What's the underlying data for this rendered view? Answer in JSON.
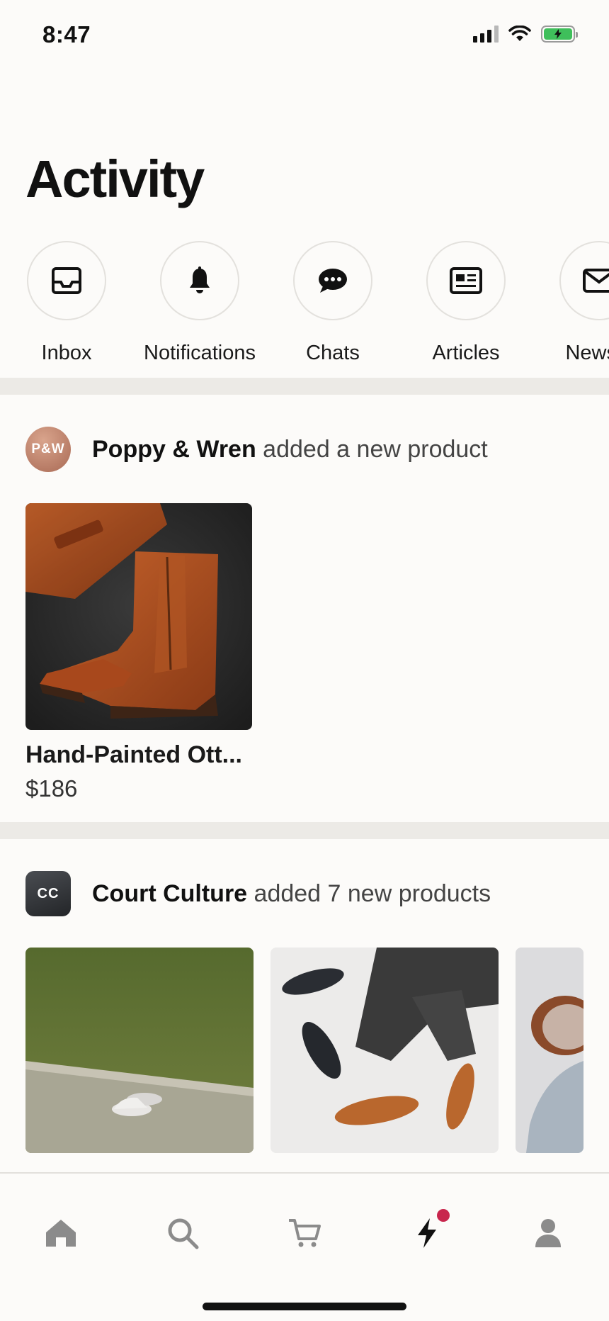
{
  "status_bar": {
    "time": "8:47"
  },
  "page_title": "Activity",
  "categories": [
    {
      "label": "Inbox",
      "icon": "inbox-icon"
    },
    {
      "label": "Notifications",
      "icon": "bell-icon"
    },
    {
      "label": "Chats",
      "icon": "chat-bubble-icon"
    },
    {
      "label": "Articles",
      "icon": "newspaper-icon"
    },
    {
      "label": "Newsle",
      "icon": "envelope-icon",
      "has_badge": true
    }
  ],
  "feed": [
    {
      "shop_initials": "P&W",
      "shop_name": "Poppy & Wren",
      "action": " added a new product",
      "products": [
        {
          "name": "Hand-Painted Ott...",
          "price": "$186"
        }
      ]
    },
    {
      "shop_initials": "CC",
      "shop_name": "Court Culture",
      "action": " added 7 new products"
    }
  ],
  "tab_bar": [
    {
      "icon": "home-icon"
    },
    {
      "icon": "search-icon"
    },
    {
      "icon": "cart-icon"
    },
    {
      "icon": "lightning-icon",
      "active": true,
      "has_badge": true
    },
    {
      "icon": "profile-icon"
    }
  ],
  "colors": {
    "badge": "#c8264d",
    "battery": "#3fbf5b",
    "divider": "#eceae6",
    "background": "#fcfbf9"
  }
}
